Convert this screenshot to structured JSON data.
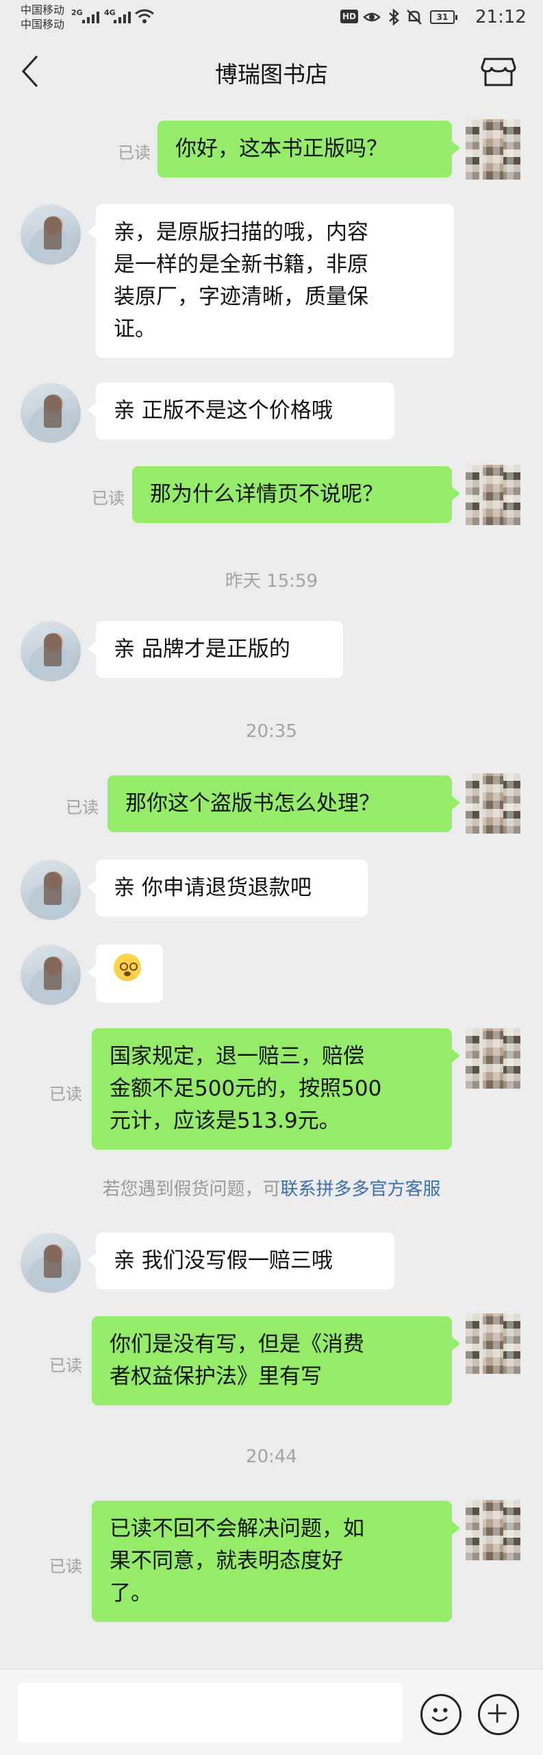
{
  "status_bar": {
    "carrier_1": "中国移动",
    "carrier_2": "中国移动",
    "network_1": "2G",
    "network_2": "4G",
    "hd": "HD",
    "battery": "31",
    "time": "21:12"
  },
  "header": {
    "title": "博瑞图书店",
    "icons": [
      "back-icon",
      "store-icon"
    ]
  },
  "messages": [
    {
      "from": "me",
      "read_label": "已读",
      "text_lines": [
        "你好，这本书正版吗？"
      ]
    },
    {
      "from": "shop",
      "text_lines": [
        "亲，是原版扫描的哦，内容",
        "是一样的是全新书籍，非原",
        "装原厂，字迹清晰，质量保",
        "证。"
      ]
    },
    {
      "from": "shop",
      "text_lines": [
        "亲 正版不是这个价格哦"
      ]
    },
    {
      "from": "me",
      "read_label": "已读",
      "text_lines": [
        "那为什么详情页不说呢？"
      ]
    },
    {
      "type": "time",
      "text": "昨天 15:59"
    },
    {
      "from": "shop",
      "text_lines": [
        "亲 品牌才是正版的"
      ]
    },
    {
      "type": "time",
      "text": "20:35"
    },
    {
      "from": "me",
      "read_label": "已读",
      "text_lines": [
        "那你这个盗版书怎么处理？"
      ]
    },
    {
      "from": "shop",
      "text_lines": [
        "亲 你申请退货退款吧"
      ]
    },
    {
      "from": "shop",
      "emoji": "flushed-face-emoji"
    },
    {
      "from": "me",
      "read_label": "已读",
      "text_lines": [
        "国家规定，退一赔三，赔偿",
        "金额不足500元的，按照500",
        "元计，应该是513.9元。"
      ]
    },
    {
      "type": "notice",
      "text": "若您遇到假货问题，可",
      "link": "联系拼多多官方客服"
    },
    {
      "from": "shop",
      "text_lines": [
        "亲 我们没写假一赔三哦"
      ]
    },
    {
      "from": "me",
      "read_label": "已读",
      "text_lines": [
        "你们是没有写，但是《消费",
        "者权益保护法》里有写"
      ]
    },
    {
      "type": "time",
      "text": "20:44"
    },
    {
      "from": "me",
      "read_label": "已读",
      "text_lines": [
        "已读不回不会解决问题，如",
        "果不同意，就表明态度好",
        "了。"
      ]
    }
  ],
  "input_bar": {
    "placeholder": "",
    "icons": [
      "emoji-icon",
      "plus-icon"
    ]
  },
  "colors": {
    "background": "#ececec",
    "outgoing_bubble": "#95ec69",
    "incoming_bubble": "#ffffff",
    "link": "#3a6fb0"
  }
}
